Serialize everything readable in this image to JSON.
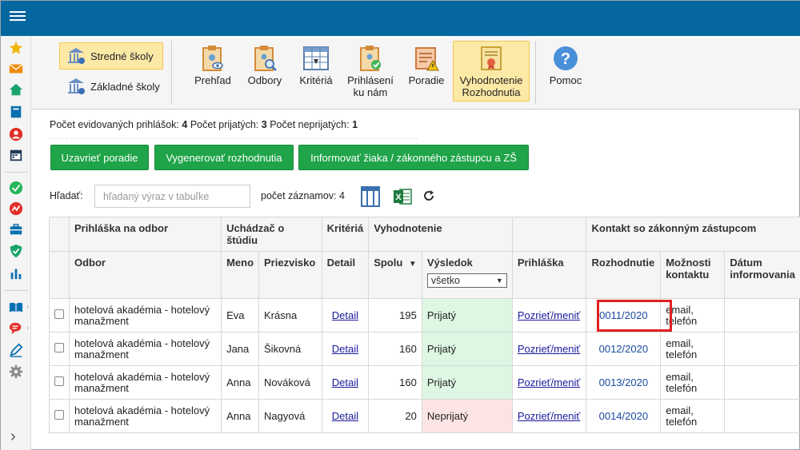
{
  "ribbon": {
    "schools": [
      {
        "label": "Stredné školy",
        "active": true
      },
      {
        "label": "Základné školy",
        "active": false
      }
    ],
    "buttons": [
      {
        "label": "Prehľad",
        "icon": "clipboard-eye-icon"
      },
      {
        "label": "Odbory",
        "icon": "clipboard-search-icon"
      },
      {
        "label": "Kritériá",
        "icon": "table-icon"
      },
      {
        "label": "Prihlásení\nku nám",
        "icon": "clipboard-check-icon"
      },
      {
        "label": "Poradie",
        "icon": "list-warning-icon"
      },
      {
        "label": "Vyhodnotenie\nRozhodnutia",
        "icon": "certificate-icon"
      },
      {
        "label": "Pomoc",
        "icon": "help-icon"
      }
    ]
  },
  "summary": {
    "label1": "Počet evidovaných prihlášok:",
    "value1": "4",
    "label2": "Počet prijatých:",
    "value2": "3",
    "label3": "Počet neprijatých:",
    "value3": "1"
  },
  "actions": {
    "close_order": "Uzavrieť poradie",
    "generate": "Vygenerovať rozhodnutia",
    "inform": "Informovať žiaka / zákonného zástupcu a ZŠ"
  },
  "search": {
    "label": "Hľadať:",
    "placeholder": "hľadaný výraz v tabuľke",
    "count_label": "počet záznamov: 4"
  },
  "table": {
    "group_headers": {
      "application": "Prihláška na odbor",
      "applicant": "Uchádzač o štúdiu",
      "criteria": "Kritériá",
      "evaluation": "Vyhodnotenie",
      "contact": "Kontakt so zákonným zástupcom"
    },
    "headers": {
      "field": "Odbor",
      "first_name": "Meno",
      "last_name": "Priezvisko",
      "detail": "Detail",
      "total": "Spolu",
      "result": "Výsledok",
      "application": "Prihláška",
      "decision": "Rozhodnutie",
      "contact_options": "Možnosti kontaktu",
      "date_informed": "Dátum informovania"
    },
    "result_filter": "všetko",
    "rows": [
      {
        "field": "hotelová akadémia - hotelový manažment",
        "first_name": "Eva",
        "last_name": "Krásna",
        "detail": "Detail",
        "total": "195",
        "result": "Prijatý",
        "accepted": true,
        "application": "Pozrieť/meniť",
        "decision": "0011/2020",
        "contact": "email, telefón",
        "date": ""
      },
      {
        "field": "hotelová akadémia - hotelový manažment",
        "first_name": "Jana",
        "last_name": "Šikovná",
        "detail": "Detail",
        "total": "160",
        "result": "Prijatý",
        "accepted": true,
        "application": "Pozrieť/meniť",
        "decision": "0012/2020",
        "contact": "email, telefón",
        "date": ""
      },
      {
        "field": "hotelová akadémia - hotelový manažment",
        "first_name": "Anna",
        "last_name": "Nováková",
        "detail": "Detail",
        "total": "160",
        "result": "Prijatý",
        "accepted": true,
        "application": "Pozrieť/meniť",
        "decision": "0013/2020",
        "contact": "email, telefón",
        "date": ""
      },
      {
        "field": "hotelová akadémia - hotelový manažment",
        "first_name": "Anna",
        "last_name": "Nagyová",
        "detail": "Detail",
        "total": "20",
        "result": "Neprijatý",
        "accepted": false,
        "application": "Pozrieť/meniť",
        "decision": "0014/2020",
        "contact": "email, telefón",
        "date": ""
      }
    ]
  },
  "colors": {
    "topbar": "#05679f",
    "primary_button": "#1fa449",
    "accepted_bg": "#ddf7e3",
    "rejected_bg": "#fde4e4",
    "highlight": "#e02020"
  }
}
